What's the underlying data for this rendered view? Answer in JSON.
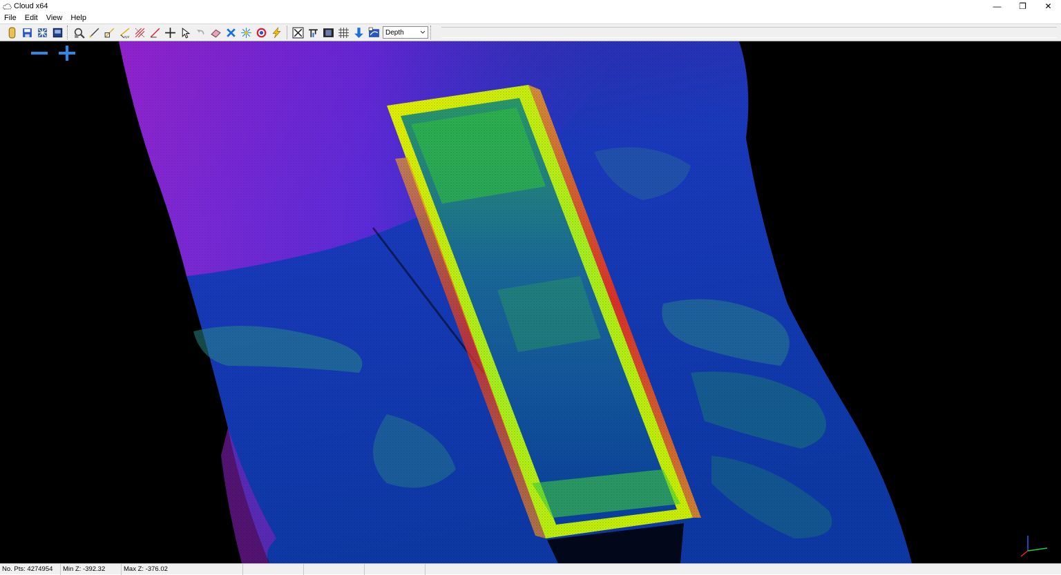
{
  "window": {
    "title": "Cloud x64",
    "minimize": "—",
    "restore": "❐",
    "close": "✕"
  },
  "menu": [
    "File",
    "Edit",
    "View",
    "Help"
  ],
  "toolbar": {
    "icons": [
      "open-icon",
      "save-icon",
      "export-icon",
      "save-as-icon",
      "zoom-inspect-icon",
      "draw-line-icon",
      "measure-icon",
      "xyz-coordinate-icon",
      "hatch-icon",
      "profile-line-icon",
      "crosshair-icon",
      "select-pointer-icon",
      "undo-icon",
      "eraser-icon",
      "delete-points-icon",
      "sparkle-icon",
      "target-icon",
      "lightning-icon",
      "fit-view-icon",
      "filter-icon",
      "render-icon",
      "grid-icon",
      "down-arrow-icon",
      "color-map-icon"
    ],
    "color_mode": "Depth",
    "accent": "#1e6fd9"
  },
  "viewport": {
    "zoom_out": "−",
    "zoom_in": "+",
    "background": "#000000"
  },
  "status": {
    "points": "No. Pts: 4274954",
    "min_z": "Min Z: -392.32",
    "max_z": "Max Z: -376.02"
  }
}
